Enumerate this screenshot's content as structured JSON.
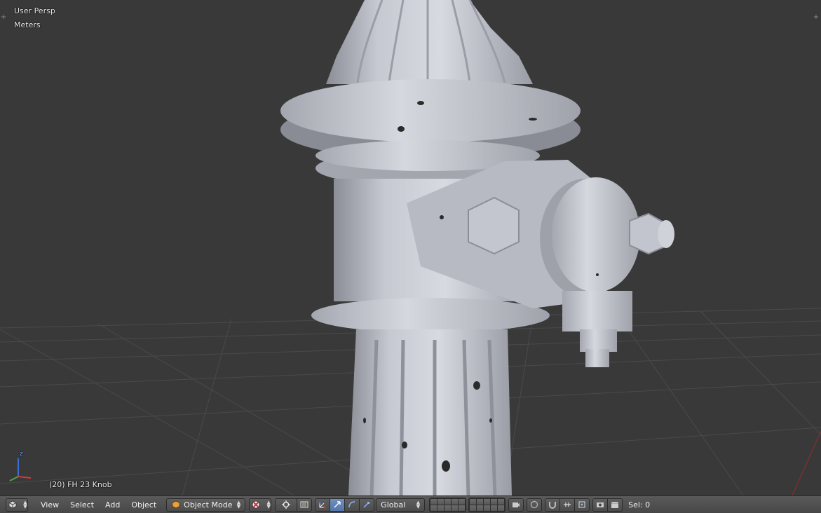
{
  "viewport": {
    "view_name": "User Persp",
    "units": "Meters",
    "active_object": "(20) FH 23 Knob",
    "background_color": "#393939",
    "object_color": "#c9cbd4"
  },
  "axis_gizmo": {
    "z_label": "z",
    "x_color": "#d23a3a",
    "y_color": "#49a845",
    "z_color": "#3c6fd1"
  },
  "header": {
    "editor_type_icon": "3d-view-icon",
    "menus": [
      "View",
      "Select",
      "Add",
      "Object"
    ],
    "mode": {
      "label": "Object Mode",
      "icon": "cube-icon"
    },
    "viewport_shading_icon": "shading-icon",
    "pivot_icon": "pivot-icon",
    "transform_orientation": "Global",
    "layer_count": 20,
    "status": "Sel: 0"
  }
}
